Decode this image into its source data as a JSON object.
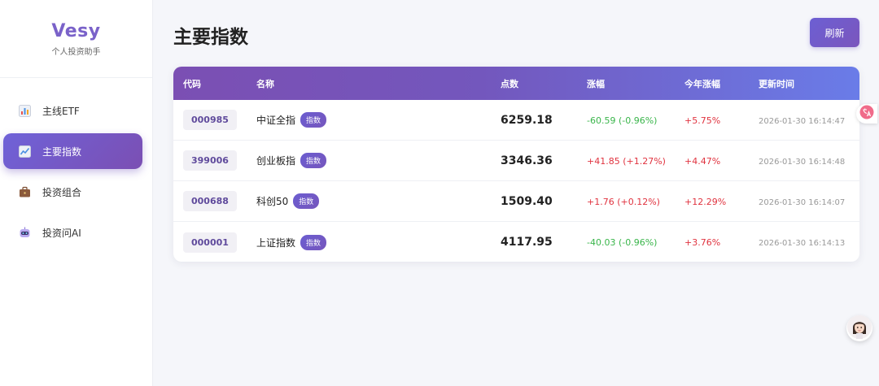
{
  "brand": {
    "name": "Vesy",
    "subtitle": "个人投资助手"
  },
  "nav": [
    {
      "label": "主线ETF",
      "icon": "bar-chart-icon"
    },
    {
      "label": "主要指数",
      "icon": "line-chart-icon",
      "active": true
    },
    {
      "label": "投资组合",
      "icon": "briefcase-icon"
    },
    {
      "label": "投资问AI",
      "icon": "robot-icon"
    }
  ],
  "page": {
    "title": "主要指数",
    "refresh_label": "刷新"
  },
  "table": {
    "headers": {
      "code": "代码",
      "name": "名称",
      "price": "点数",
      "change": "涨幅",
      "ytd": "今年涨幅",
      "time": "更新时间"
    },
    "tag_label": "指数",
    "rows": [
      {
        "code": "000985",
        "name": "中证全指",
        "price": "6259.18",
        "change": "-60.59 (-0.96%)",
        "direction": "down",
        "ytd": "+5.75%",
        "time": "2026-01-30 16:14:47"
      },
      {
        "code": "399006",
        "name": "创业板指",
        "price": "3346.36",
        "change": "+41.85 (+1.27%)",
        "direction": "up",
        "ytd": "+4.47%",
        "time": "2026-01-30 16:14:48"
      },
      {
        "code": "000688",
        "name": "科创50",
        "price": "1509.40",
        "change": "+1.76 (+0.12%)",
        "direction": "up",
        "ytd": "+12.29%",
        "time": "2026-01-30 16:14:07"
      },
      {
        "code": "000001",
        "name": "上证指数",
        "price": "4117.95",
        "change": "-40.03 (-0.96%)",
        "direction": "down",
        "ytd": "+3.76%",
        "time": "2026-01-30 16:14:13"
      }
    ]
  },
  "colors": {
    "accent": "#7357bd",
    "up": "#e0333f",
    "down": "#39b54a"
  }
}
